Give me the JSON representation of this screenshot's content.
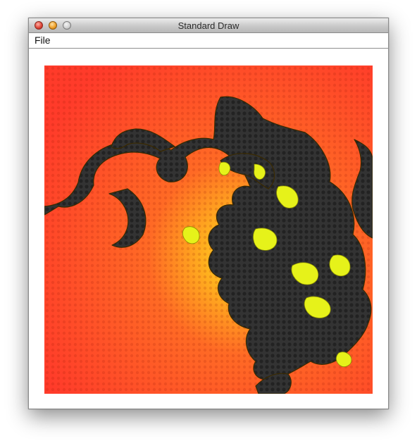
{
  "window": {
    "title": "Standard Draw",
    "menu": [
      "File"
    ]
  },
  "canvas": {
    "description_icon": "fractal-image",
    "colors": {
      "background_red": "#ff3b2a",
      "glow_orange": "#ffb21e",
      "glow_yellow": "#ffd23a",
      "fractal_dark": "#2f2f2f",
      "fractal_highlight": "#e6f21a"
    }
  }
}
